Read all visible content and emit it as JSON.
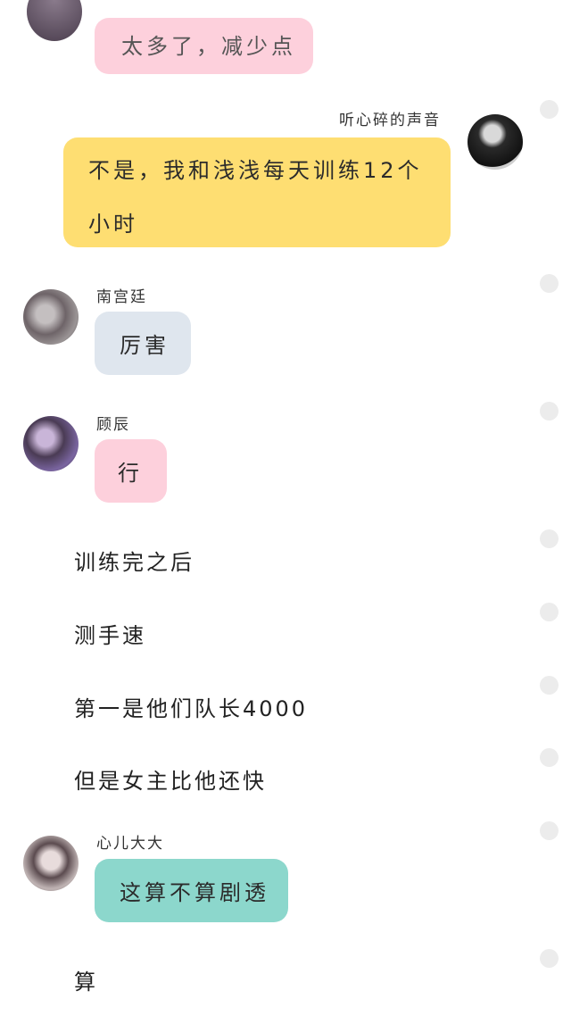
{
  "colors": {
    "pink": "#fdd0dc",
    "yellow": "#fede72",
    "gray_blue": "#dfe6ee",
    "teal": "#8cd7cc",
    "select_dot": "#ececec"
  },
  "messages": [
    {
      "type": "bubble",
      "side": "left",
      "color": "pink",
      "text": "太多了，减少点"
    },
    {
      "type": "bubble",
      "side": "right",
      "sender": "听心碎的声音",
      "color": "yellow",
      "avatar": "avatar-dark-haired-girl",
      "text": "不是，我和浅浅每天训练12个小时"
    },
    {
      "type": "bubble",
      "side": "left",
      "sender": "南宫廷",
      "color": "gray_blue",
      "avatar": "avatar-gray-boy",
      "text": "厉害"
    },
    {
      "type": "bubble",
      "side": "left",
      "sender": "顾辰",
      "color": "pink",
      "avatar": "avatar-purple-boy",
      "text": "行"
    },
    {
      "type": "narration",
      "text": "训练完之后"
    },
    {
      "type": "narration",
      "text": "测手速"
    },
    {
      "type": "narration",
      "text": "第一是他们队长4000"
    },
    {
      "type": "narration",
      "text": "但是女主比他还快"
    },
    {
      "type": "bubble",
      "side": "left",
      "sender": "心儿大大",
      "color": "teal",
      "avatar": "avatar-long-haired-girl",
      "text": "这算不算剧透"
    },
    {
      "type": "narration",
      "text": "算"
    }
  ]
}
